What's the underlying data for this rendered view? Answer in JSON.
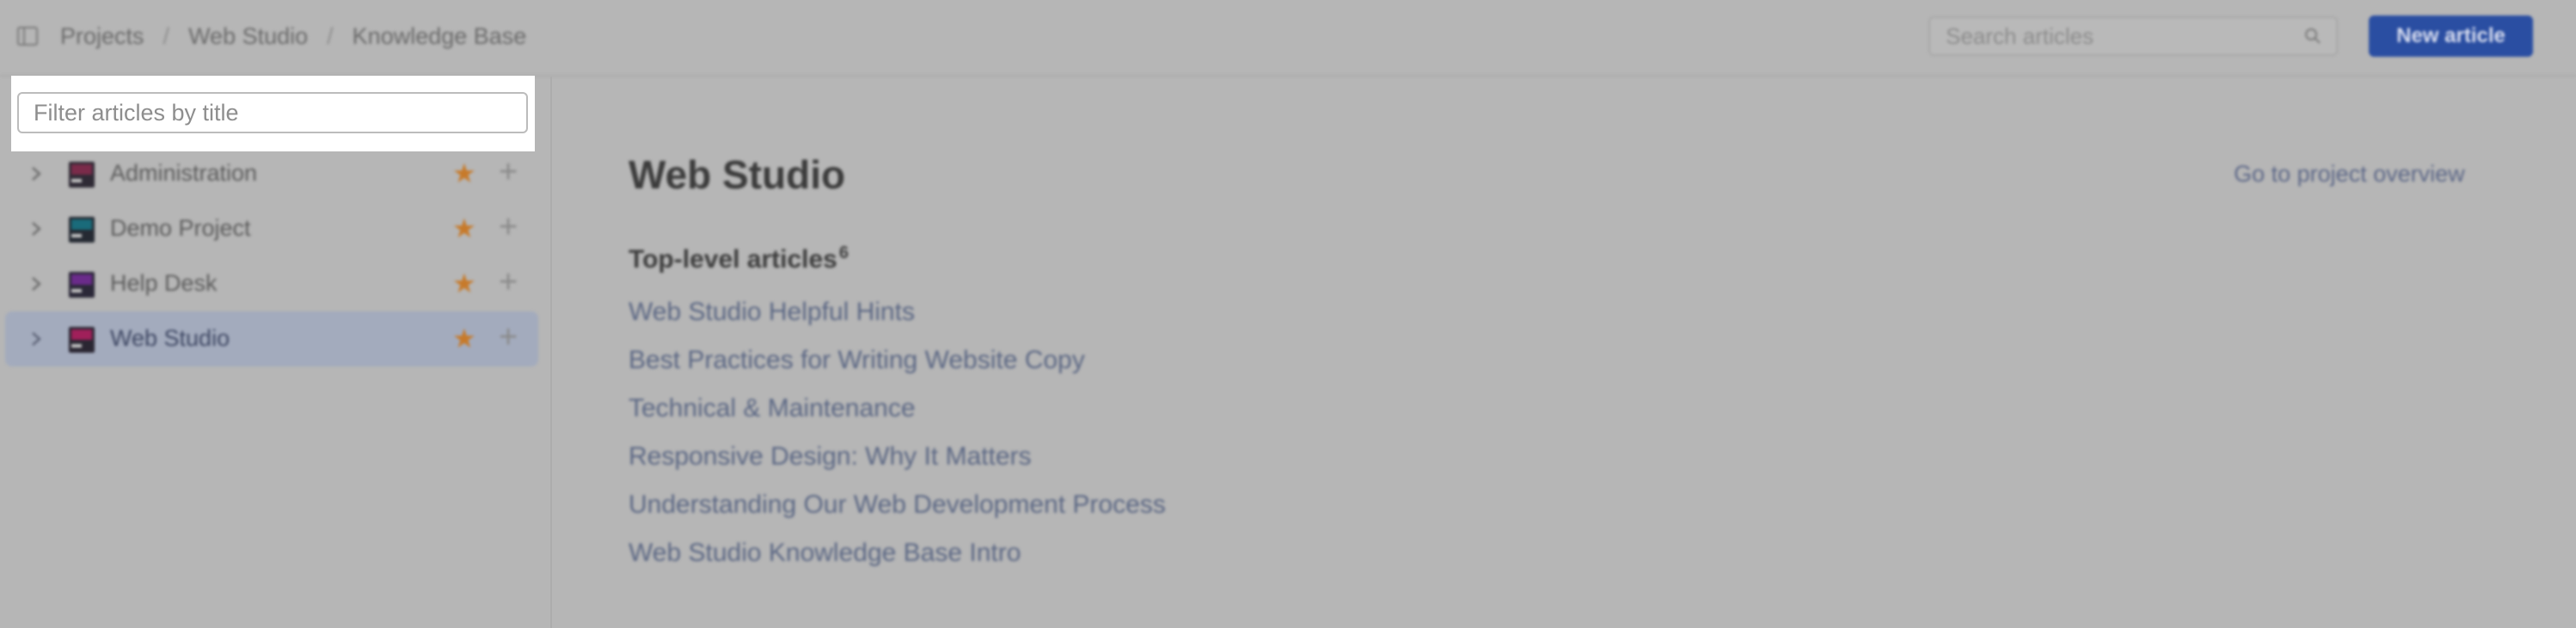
{
  "topbar": {
    "breadcrumb": [
      "Projects",
      "Web Studio",
      "Knowledge Base"
    ],
    "search": {
      "placeholder": "Search articles",
      "value": ""
    },
    "new_article_label": "New article",
    "icons": {
      "sidebar_toggle": "sidebar-toggle-icon",
      "search": "search-icon"
    }
  },
  "sidebar": {
    "filter": {
      "placeholder": "Filter articles by title",
      "value": ""
    },
    "projects": [
      {
        "name": "Administration",
        "starred": true,
        "logo_colors": [
          "#7a2b4a",
          "#3a2b3f"
        ]
      },
      {
        "name": "Demo Project",
        "starred": true,
        "logo_colors": [
          "#1a6b7a",
          "#2b2b3f"
        ]
      },
      {
        "name": "Help Desk",
        "starred": true,
        "logo_colors": [
          "#6a2b8a",
          "#2b2b3f"
        ]
      },
      {
        "name": "Web Studio",
        "starred": true,
        "selected": true,
        "logo_colors": [
          "#a0205a",
          "#2b2b3f"
        ]
      }
    ]
  },
  "main": {
    "title": "Web Studio",
    "overview_link": "Go to project overview",
    "section_title": "Top-level articles",
    "article_count": "6",
    "articles": [
      "Web Studio Helpful Hints",
      "Best Practices for Writing Website Copy",
      "Technical & Maintenance",
      "Responsive Design: Why It Matters",
      "Understanding Our Web Development Process",
      "Web Studio Knowledge Base Intro"
    ]
  },
  "colors": {
    "accent": "#2a4ea2",
    "star": "#c77a2a",
    "link": "#5b6784",
    "selected_row": "#a3abbd"
  }
}
